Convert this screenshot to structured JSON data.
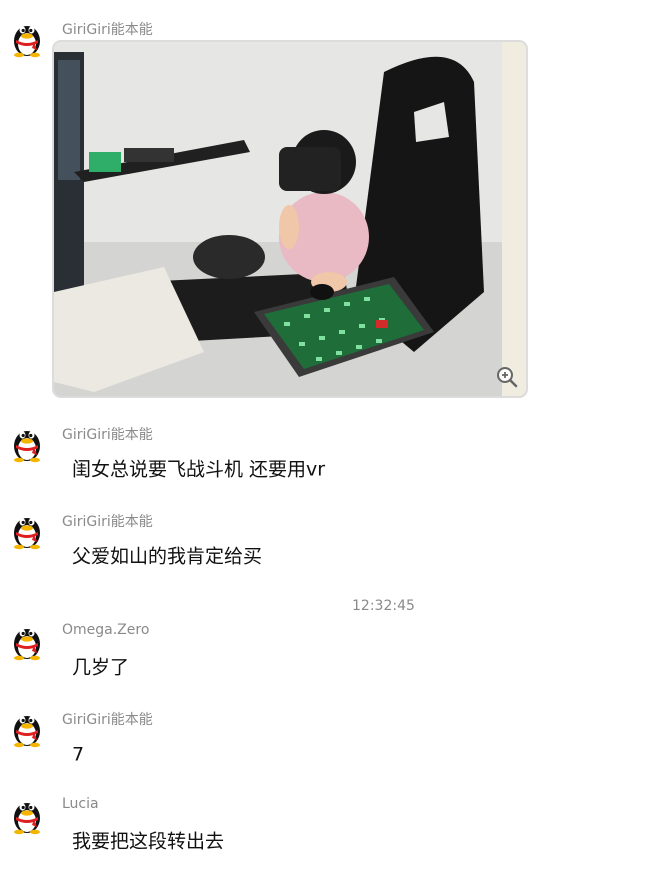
{
  "photo": {
    "sender": "GiriGiri能本能"
  },
  "timestamp": "12:32:45",
  "messages": [
    {
      "sender": "GiriGiri能本能",
      "text": "闺女总说要飞战斗机 还要用vr"
    },
    {
      "sender": "GiriGiri能本能",
      "text": "父爱如山的我肯定给买"
    },
    {
      "sender": "Omega.Zero",
      "text": "几岁了"
    },
    {
      "sender": "GiriGiri能本能",
      "text": "7"
    },
    {
      "sender": "Lucia",
      "text": "我要把这段转出去"
    }
  ],
  "icons": {
    "avatar": "penguin-avatar-icon",
    "zoom": "zoom-in-icon"
  }
}
